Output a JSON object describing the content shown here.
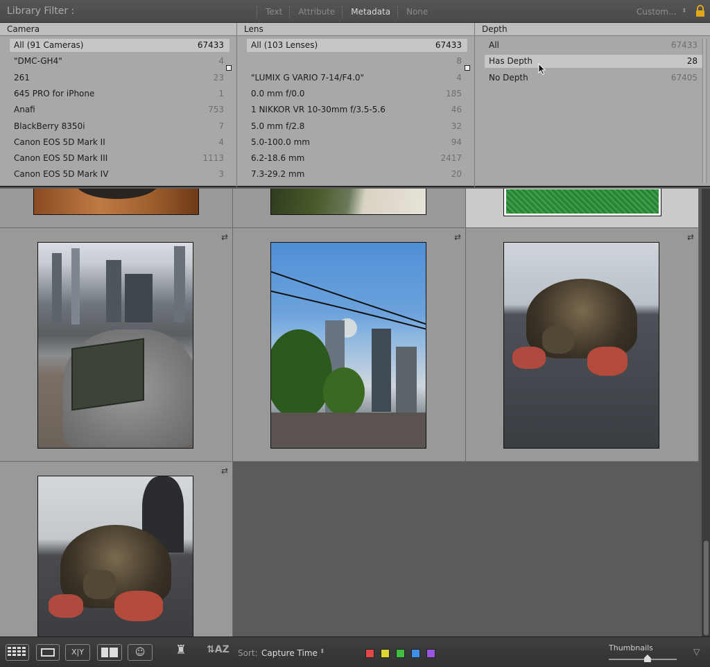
{
  "filter_bar": {
    "title": "Library Filter :",
    "tabs": [
      {
        "label": "Text",
        "active": false
      },
      {
        "label": "Attribute",
        "active": false
      },
      {
        "label": "Metadata",
        "active": true
      },
      {
        "label": "None",
        "active": false
      }
    ],
    "preset": "Custom...",
    "lock_icon": "lock-icon"
  },
  "columns": {
    "camera": {
      "header": "Camera",
      "rows": [
        {
          "label": "All (91 Cameras)",
          "count": "67433",
          "selected": true
        },
        {
          "label": "\"DMC-GH4\"",
          "count": "4"
        },
        {
          "label": "261",
          "count": "23"
        },
        {
          "label": "645 PRO for iPhone",
          "count": "1"
        },
        {
          "label": "Anafi",
          "count": "753"
        },
        {
          "label": "BlackBerry 8350i",
          "count": "7"
        },
        {
          "label": "Canon EOS 5D Mark II",
          "count": "4"
        },
        {
          "label": "Canon EOS 5D Mark III",
          "count": "1113"
        },
        {
          "label": "Canon EOS 5D Mark IV",
          "count": "3"
        }
      ]
    },
    "lens": {
      "header": "Lens",
      "rows": [
        {
          "label": "All (103 Lenses)",
          "count": "67433",
          "selected": true
        },
        {
          "label": "",
          "count": "8"
        },
        {
          "label": "\"LUMIX G VARIO 7-14/F4.0\"",
          "count": "4"
        },
        {
          "label": "0.0 mm f/0.0",
          "count": "185"
        },
        {
          "label": "1 NIKKOR VR 10-30mm f/3.5-5.6",
          "count": "46"
        },
        {
          "label": "5.0 mm f/2.8",
          "count": "32"
        },
        {
          "label": "5.0-100.0 mm",
          "count": "94"
        },
        {
          "label": "6.2-18.6 mm",
          "count": "2417"
        },
        {
          "label": "7.3-29.2 mm",
          "count": "20"
        }
      ]
    },
    "depth": {
      "header": "Depth",
      "rows": [
        {
          "label": "All",
          "count": "67433"
        },
        {
          "label": "Has Depth",
          "count": "28",
          "selected": true
        },
        {
          "label": "No Depth",
          "count": "67405"
        }
      ]
    }
  },
  "photos": [
    {
      "name": "wood-partial"
    },
    {
      "name": "plant-partial"
    },
    {
      "name": "grass-partial"
    },
    {
      "name": "city-rock-plaque"
    },
    {
      "name": "string-lights-skyline"
    },
    {
      "name": "tortoise-1"
    },
    {
      "name": "tortoise-2"
    }
  ],
  "toolbar": {
    "sort_label": "Sort:",
    "sort_value": "Capture Time",
    "compare_label": "X|Y",
    "thumbnails_label": "Thumbnails",
    "thumbnail_size": 0.57,
    "flags": [
      "#e04848",
      "#e0d630",
      "#3fbf3f",
      "#3f8fe6",
      "#9a56e0"
    ]
  }
}
